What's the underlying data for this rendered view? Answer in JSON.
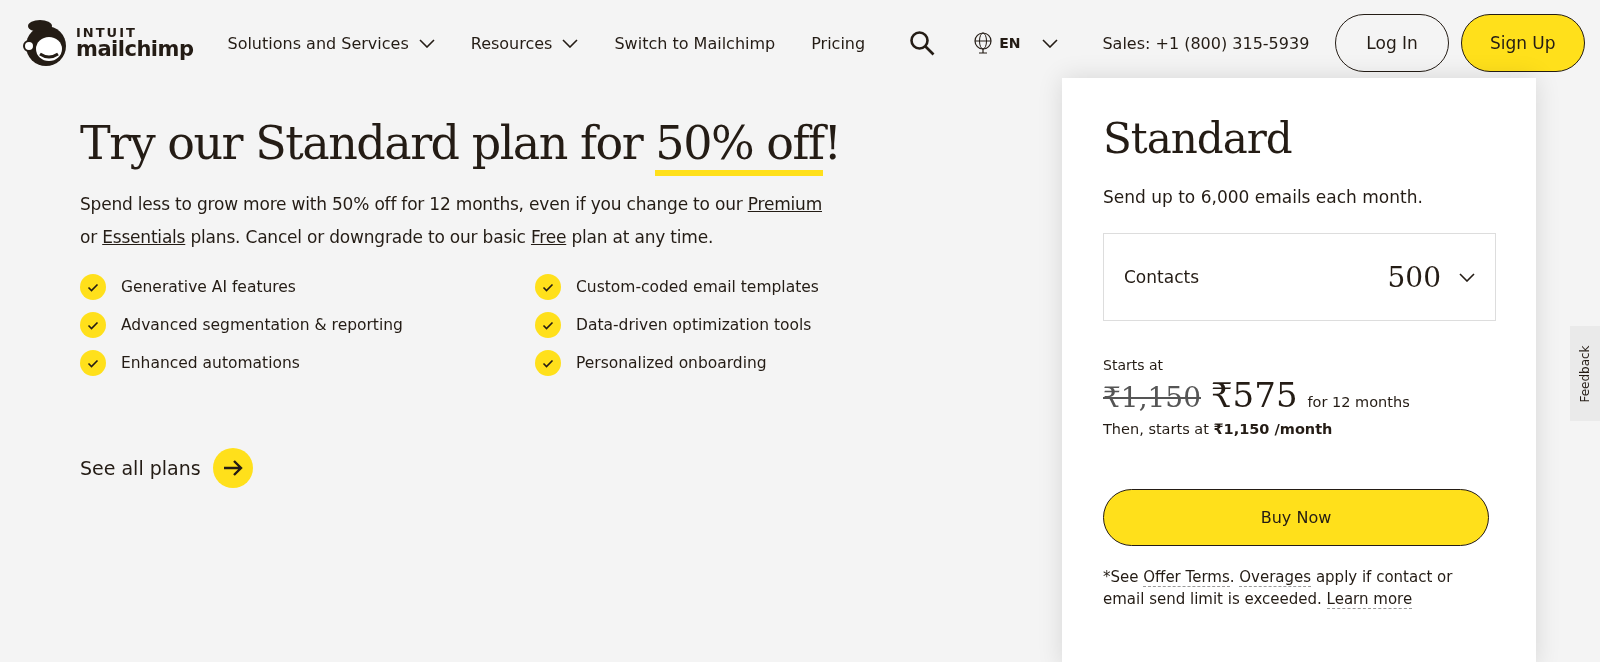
{
  "header": {
    "logo": {
      "top": "INTUIT",
      "bottom": "mailchimp"
    },
    "nav": [
      {
        "label": "Solutions and Services",
        "dropdown": true
      },
      {
        "label": "Resources",
        "dropdown": true
      },
      {
        "label": "Switch to Mailchimp",
        "dropdown": false
      },
      {
        "label": "Pricing",
        "dropdown": false
      }
    ],
    "language": "EN",
    "sales": "Sales: +1 (800) 315-5939",
    "login": "Log In",
    "signup": "Sign Up"
  },
  "hero": {
    "heading": [
      {
        "kind": "text",
        "text": "Try our Standard plan for "
      },
      {
        "kind": "highlight",
        "text": "50% off"
      },
      {
        "kind": "text",
        "text": "!"
      }
    ],
    "intro": [
      {
        "kind": "text",
        "text": "Spend less to grow more with 50% off for 12 months, even if you change to our "
      },
      {
        "kind": "link",
        "text": "Premium"
      },
      {
        "kind": "text",
        "text": " or "
      },
      {
        "kind": "link",
        "text": "Essentials"
      },
      {
        "kind": "text",
        "text": " plans. Cancel or downgrade to our basic "
      },
      {
        "kind": "link",
        "text": "Free"
      },
      {
        "kind": "text",
        "text": " plan at any time."
      }
    ],
    "features": [
      "Generative AI features",
      "Custom-coded email templates",
      "Advanced segmentation & reporting",
      "Data-driven optimization tools",
      "Enhanced automations",
      "Personalized onboarding"
    ],
    "see_all": "See all plans"
  },
  "card": {
    "title": "Standard",
    "subtitle": "Send up to 6,000 emails each month.",
    "contacts_label": "Contacts",
    "contacts_value": "500",
    "starts_at": "Starts at",
    "old_price": "₹1,150",
    "price": "₹575",
    "price_note": "for 12 months",
    "then": [
      {
        "kind": "text",
        "text": "Then, starts at "
      },
      {
        "kind": "bold",
        "text": "₹1,150 /month"
      }
    ],
    "buy": "Buy Now",
    "terms": [
      {
        "kind": "text",
        "text": "*See "
      },
      {
        "kind": "link",
        "text": "Offer Terms"
      },
      {
        "kind": "text",
        "text": ". "
      },
      {
        "kind": "link",
        "text": "Overages"
      },
      {
        "kind": "text",
        "text": " apply if contact or email send limit is exceeded. "
      },
      {
        "kind": "link",
        "text": "Learn more"
      }
    ]
  },
  "feedback": "Feedback"
}
